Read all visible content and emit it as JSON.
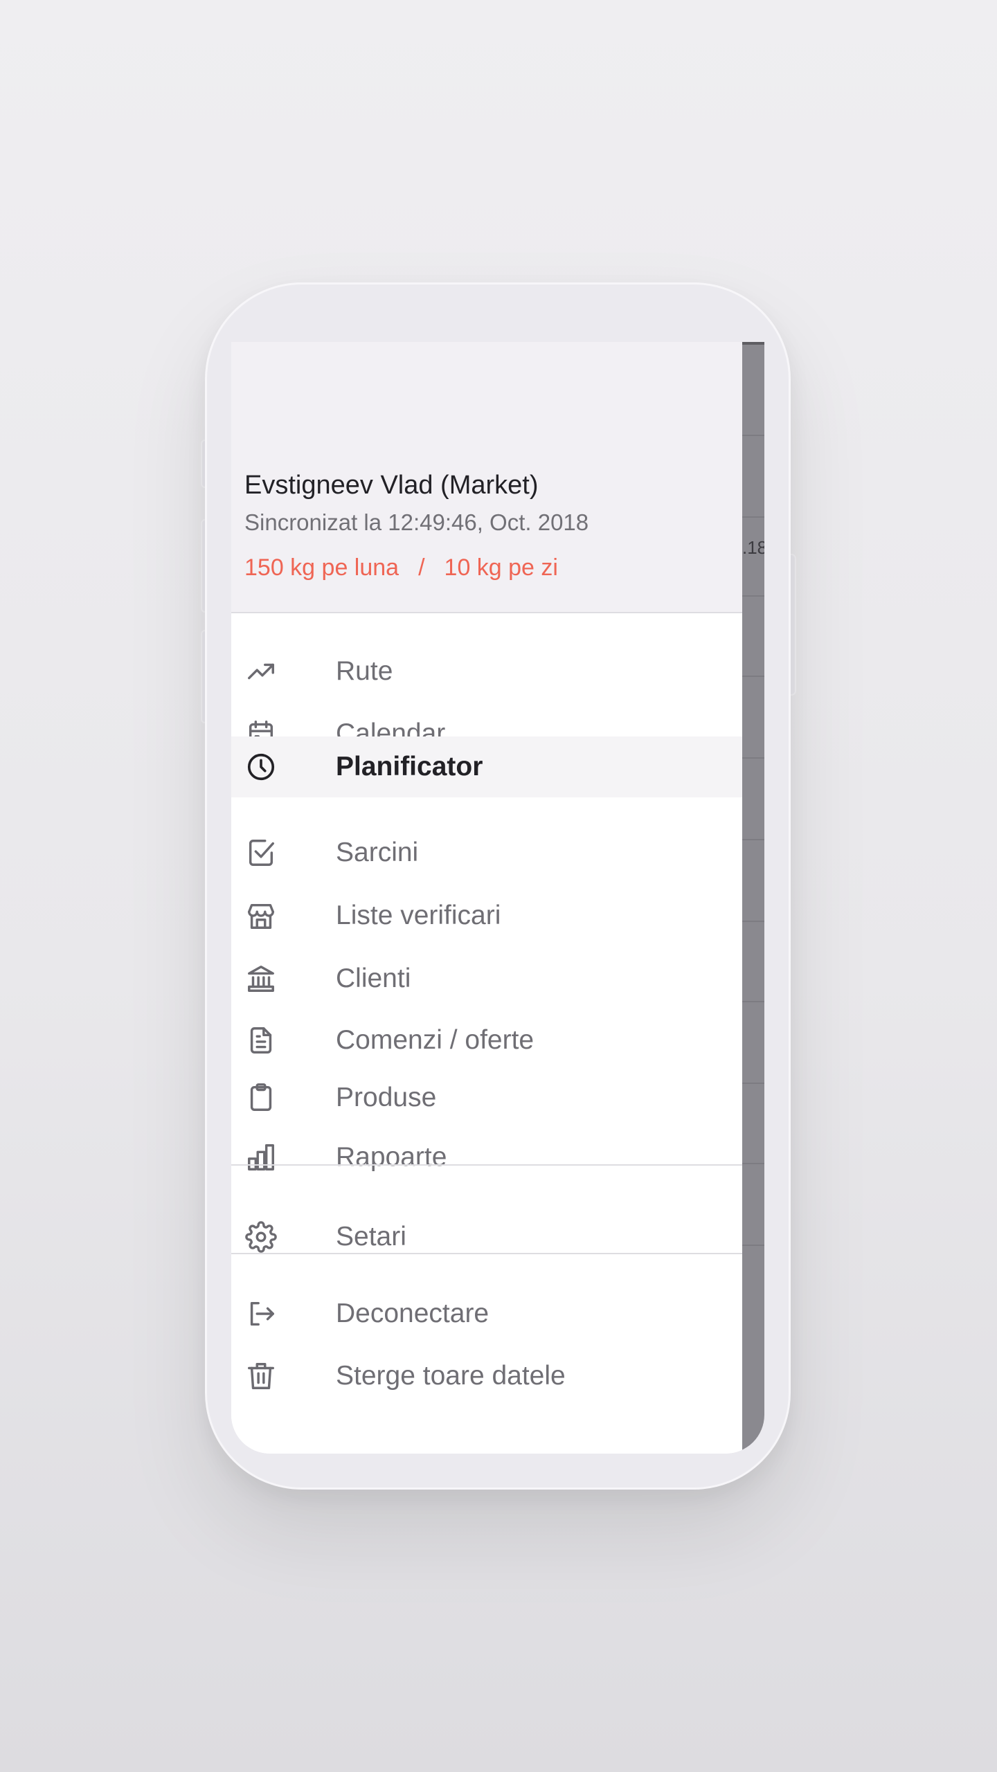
{
  "drawer": {
    "user_name": "Evstigneev Vlad (Market)",
    "sync_status": "Sincronizat la 12:49:46, Oct. 2018",
    "quota_month": "150 kg pe luna",
    "quota_separator": "/",
    "quota_day": "10 kg pe zi"
  },
  "menu": {
    "items": [
      {
        "label": "Rute",
        "icon": "trending-up-icon"
      },
      {
        "label": "Calendar",
        "icon": "calendar-icon"
      },
      {
        "label": "Planificator",
        "icon": "clock-icon",
        "active": true
      },
      {
        "label": "Sarcini",
        "icon": "checkbox-icon"
      },
      {
        "label": "Liste verificari",
        "icon": "store-icon"
      },
      {
        "label": "Clienti",
        "icon": "bank-icon"
      },
      {
        "label": "Comenzi / oferte",
        "icon": "document-icon"
      },
      {
        "label": "Produse",
        "icon": "clipboard-icon"
      },
      {
        "label": "Rapoarte",
        "icon": "bar-chart-icon"
      }
    ],
    "settings": [
      {
        "label": "Setari",
        "icon": "gear-icon"
      }
    ],
    "account": [
      {
        "label": "Deconectare",
        "icon": "logout-icon"
      },
      {
        "label": "Sterge toare datele",
        "icon": "trash-icon"
      }
    ]
  },
  "background": {
    "snippet": ".18"
  },
  "colors": {
    "accent": "#ef6554",
    "active_text": "#222126",
    "menu_text": "#6f6e74",
    "header_bg": "#f2f0f4",
    "active_bg": "#f5f4f6"
  }
}
